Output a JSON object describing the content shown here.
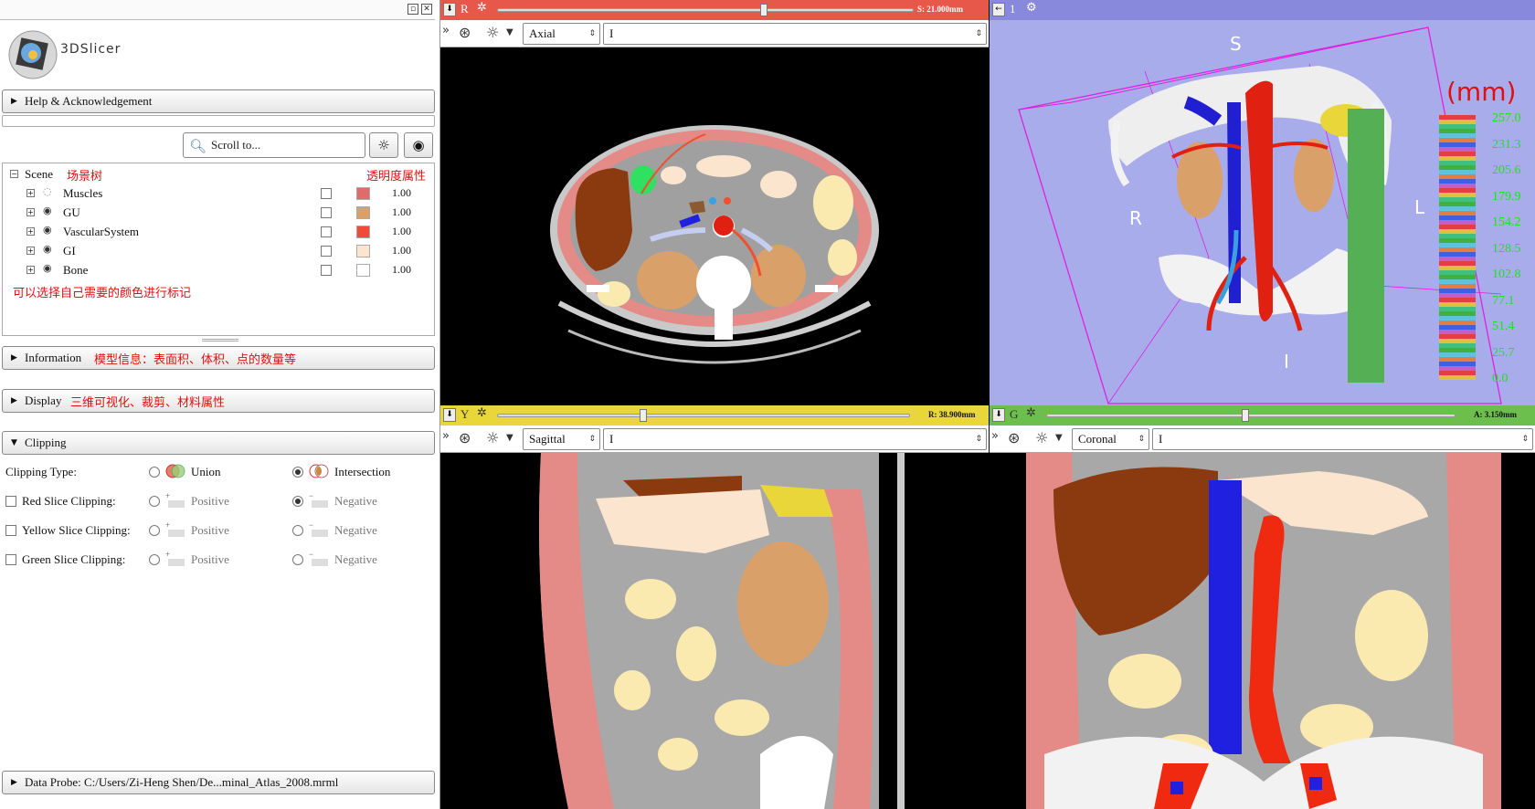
{
  "app": {
    "logo_text": "3DSlicer"
  },
  "panels": {
    "help": "Help & Acknowledgement",
    "information": "Information",
    "information_note": "模型信息：表面积、体积、点的数量等",
    "display": "Display",
    "display_note": "三维可视化、裁剪、材料属性",
    "clipping": "Clipping",
    "data_probe": "Data Probe: C:/Users/Zi-Heng Shen/De...minal_Atlas_2008.mrml"
  },
  "search": {
    "placeholder": "Scroll to..."
  },
  "scene_tree": {
    "root": "Scene",
    "root_note": "场景树",
    "opacity_note": "透明度属性",
    "color_note": "可以选择自己需要的颜色进行标记",
    "items": [
      {
        "name": "Muscles",
        "opacity": "1.00",
        "color": "#e06b6b"
      },
      {
        "name": "GU",
        "opacity": "1.00",
        "color": "#d9a06a"
      },
      {
        "name": "VascularSystem",
        "opacity": "1.00",
        "color": "#f04a3a"
      },
      {
        "name": "GI",
        "opacity": "1.00",
        "color": "#fbe5cf"
      },
      {
        "name": "Bone",
        "opacity": "1.00",
        "color": "#ffffff"
      }
    ]
  },
  "clipping": {
    "type_label": "Clipping Type:",
    "union": "Union",
    "intersection": "Intersection",
    "rows": [
      {
        "label": "Red Slice Clipping:",
        "positive": "Positive",
        "negative": "Negative"
      },
      {
        "label": "Yellow Slice Clipping:",
        "positive": "Positive",
        "negative": "Negative"
      },
      {
        "label": "Green Slice Clipping:",
        "positive": "Positive",
        "negative": "Negative"
      }
    ]
  },
  "views": {
    "red": {
      "letter": "R",
      "offset": "S: 21.000mm",
      "orientation": "Axial",
      "layer": "I",
      "color": "#e8584a"
    },
    "yellow": {
      "letter": "Y",
      "offset": "R: 38.900mm",
      "orientation": "Sagittal",
      "layer": "I",
      "color": "#e9d63a"
    },
    "green": {
      "letter": "G",
      "offset": "A: 3.150mm",
      "orientation": "Coronal",
      "layer": "I",
      "color": "#6cbf4c"
    },
    "three_d": {
      "letter": "1",
      "bg_color": "#a9acea",
      "labels": {
        "s": "S",
        "r": "R",
        "l": "L",
        "i": "I"
      },
      "unit": "(mm)",
      "scale": [
        "257.0",
        "231.3",
        "205.6",
        "179.9",
        "154.2",
        "128.5",
        "102.8",
        "77.1",
        "51.4",
        "25.7",
        "0.0"
      ]
    }
  }
}
